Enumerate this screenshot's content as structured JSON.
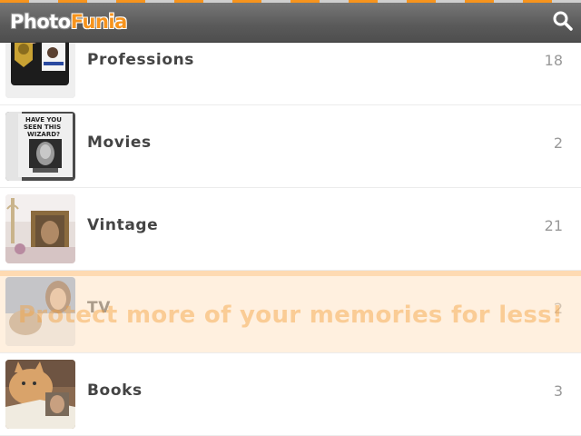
{
  "header": {
    "logo_part1": "Photo",
    "logo_part2": "Funia",
    "search_icon": "search-icon",
    "accent": "#f7941d"
  },
  "categories": [
    {
      "label": "Professions",
      "count": "18",
      "thumb_icon": "fbi-badge-photo"
    },
    {
      "label": "Movies",
      "count": "2",
      "thumb_icon": "wanted-poster-photo"
    },
    {
      "label": "Vintage",
      "count": "21",
      "thumb_icon": "vintage-frame-photo"
    },
    {
      "label": "TV",
      "count": "2",
      "thumb_icon": "tv-face-photo"
    },
    {
      "label": "Books",
      "count": "3",
      "thumb_icon": "cat-book-photo"
    }
  ],
  "banner": {
    "text": "Protect more of your memories for less!"
  }
}
